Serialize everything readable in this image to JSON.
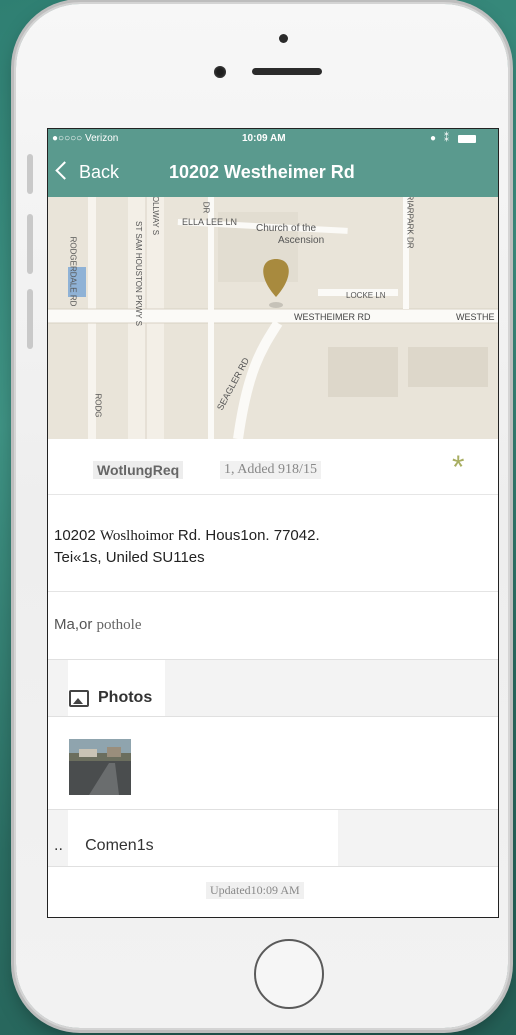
{
  "statusbar": {
    "carrier": "●○○○○ Verizon",
    "time": "10:09 AM"
  },
  "navbar": {
    "back_label": "Back",
    "title": "10202 Westheimer Rd"
  },
  "map": {
    "streets": [
      "ELLA LEE LN",
      "Church of the",
      "Ascension",
      "LOCKE LN",
      "WESTHEIMER RD",
      "WESTHE",
      "SEAGLER RD",
      "RODGERDALE RD",
      "RODG",
      "ST SAM HOUSTON PKWY S",
      "OLLWAY S",
      "DR",
      "RIARPARK DR"
    ]
  },
  "report": {
    "status": "WotlungReq",
    "added": "1, Added 918/15",
    "address_line1_a": "10202 ",
    "address_line1_b": "Woslhoimor",
    "address_line1_c": " Rd. Hous1on. 77042.",
    "address_line2": "Tei«1s,  Uniled SU11es",
    "description_a": "Ma,or ",
    "description_b": "pothole",
    "photos_label": "Photos",
    "comments_label": "Comen1s",
    "comments_prefix": "..",
    "updated": "Updated10:09 AM"
  },
  "icons": {
    "star": "favorite-star-icon",
    "photos": "photos-icon",
    "back": "chevron-left-icon",
    "pin": "map-pin-icon"
  },
  "colors": {
    "accent": "#5a9a8e",
    "star": "#a8ae62",
    "pin": "#a88a3e"
  }
}
